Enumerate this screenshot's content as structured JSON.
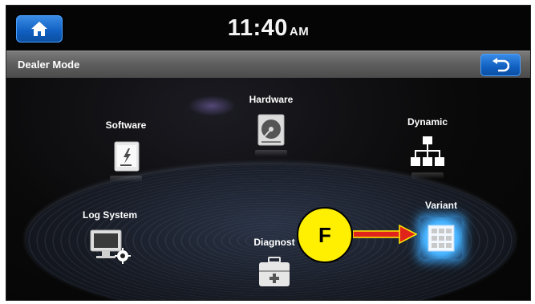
{
  "status_bar": {
    "time": "11:40",
    "ampm": "AM"
  },
  "header": {
    "title": "Dealer Mode"
  },
  "menu": {
    "items": [
      {
        "label": "Software",
        "icon": "software-update-icon"
      },
      {
        "label": "Hardware",
        "icon": "hard-disk-icon"
      },
      {
        "label": "Dynamic",
        "icon": "network-tree-icon"
      },
      {
        "label": "Log System",
        "icon": "computer-settings-icon"
      },
      {
        "label": "Diagnost",
        "icon": "toolbox-icon"
      },
      {
        "label": "Variant",
        "icon": "grid-config-icon"
      }
    ]
  },
  "annotation": {
    "marker": "F"
  },
  "colors": {
    "button_blue": "#105fc0",
    "annotation_yellow": "#ffef00",
    "annotation_arrow": "#e0241c",
    "selection_glow": "#3fb4ff"
  }
}
